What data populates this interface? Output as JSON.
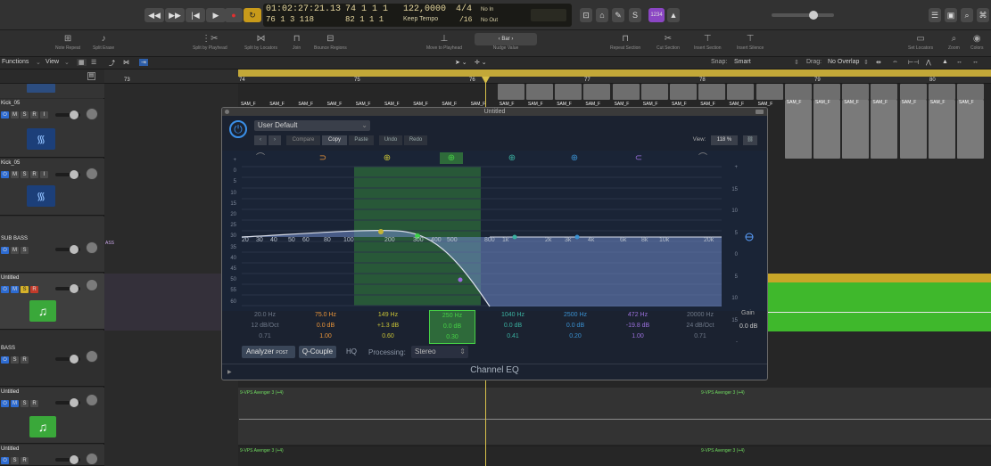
{
  "transport": {
    "position_time": "01:02:27:21.13",
    "position_bars": "74  1  1   1",
    "position_bars2": "76  1  3  118",
    "position_bars3": "82  1  1   1",
    "tempo": "122,0000",
    "tempo_mode": "Keep Tempo",
    "signature": "4/4",
    "division": "/16",
    "no_in": "No In",
    "no_out": "No Out",
    "count_badge": "1234"
  },
  "toolbar": {
    "items": [
      "Note Repeat",
      "Split Erase",
      "Split by Playhead",
      "Split by Locators",
      "Join",
      "Bounce Regions",
      "Move to Playhead",
      "Nudge Value",
      "Repeat Section",
      "Cut Section",
      "Insert Section",
      "Insert Silence",
      "Set Locators",
      "Zoom",
      "Colors"
    ],
    "nudge_value": "Bar"
  },
  "menubar": {
    "functions": "Functions",
    "view": "View",
    "snap_label": "Snap:",
    "snap_value": "Smart",
    "drag_label": "Drag:",
    "drag_value": "No Overlap"
  },
  "ruler": {
    "bars": [
      "73",
      "74",
      "75",
      "76",
      "77",
      "78",
      "79",
      "80"
    ]
  },
  "tracks": [
    {
      "name": "Kick_05"
    },
    {
      "name": "Kick_05"
    },
    {
      "name": "SUB BASS"
    },
    {
      "name": "Untitled"
    },
    {
      "name": "BASS"
    },
    {
      "name": "Untitled"
    },
    {
      "name": "Untitled"
    }
  ],
  "regions": {
    "sam": "SAM_F",
    "ass": "ASS",
    "avenger": "9-VPS Avenger 3 (+4)"
  },
  "eq": {
    "window_title": "Untitled",
    "preset": "User Default",
    "compare": "Compare",
    "copy": "Copy",
    "paste": "Paste",
    "undo": "Undo",
    "redo": "Redo",
    "view_label": "View:",
    "view_value": "118 %",
    "db_left": [
      "+",
      "0",
      "5",
      "10",
      "15",
      "20",
      "25",
      "30",
      "35",
      "40",
      "45",
      "50",
      "55",
      "60"
    ],
    "db_right": [
      "+",
      "15",
      "10",
      "5",
      "0",
      "5",
      "10",
      "15",
      "-"
    ],
    "freq_labels": [
      "20",
      "30",
      "40",
      "50",
      "60",
      "80",
      "100",
      "200",
      "300",
      "400",
      "500",
      "800",
      "1k",
      "2k",
      "3k",
      "4k",
      "6k",
      "8k",
      "10k",
      "20k"
    ],
    "bands": [
      {
        "freq": "20.0 Hz",
        "gain": "12 dB/Oct",
        "q": "0.71"
      },
      {
        "freq": "75.0 Hz",
        "gain": "0.0 dB",
        "q": "1.00"
      },
      {
        "freq": "149 Hz",
        "gain": "+1.3 dB",
        "q": "0.60"
      },
      {
        "freq": "250 Hz",
        "gain": "0.0 dB",
        "q": "0.30"
      },
      {
        "freq": "1040 Hz",
        "gain": "0.0 dB",
        "q": "0.41"
      },
      {
        "freq": "2500 Hz",
        "gain": "0.0 dB",
        "q": "0.20"
      },
      {
        "freq": "472 Hz",
        "gain": "-19.8 dB",
        "q": "1.00"
      },
      {
        "freq": "20000 Hz",
        "gain": "24 dB/Oct",
        "q": "0.71"
      }
    ],
    "gain_label": "Gain",
    "gain_value": "0.0 dB",
    "analyzer": "Analyzer",
    "analyzer_post": "POST",
    "qcouple": "Q-Couple",
    "hq": "HQ",
    "processing_label": "Processing:",
    "processing_value": "Stereo",
    "plugin_name": "Channel EQ"
  },
  "colors": {
    "accent_green": "#3aa83a",
    "ruler_yellow": "#c3a838",
    "region_green": "#3fb82c",
    "eq_bg": "#1b2230"
  }
}
